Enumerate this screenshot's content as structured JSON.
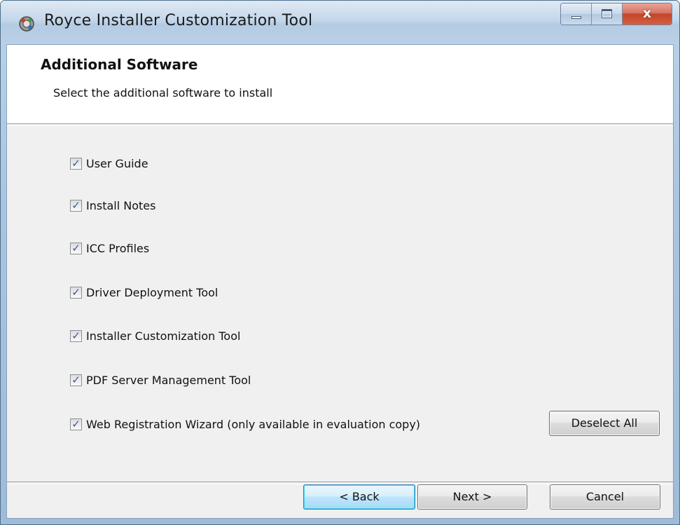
{
  "window": {
    "title": "Royce Installer Customization Tool",
    "app_icon": "installer-gear-icon",
    "controls": {
      "minimize_icon": "minimize-icon",
      "maximize_icon": "maximize-icon",
      "close_glyph": "x"
    }
  },
  "header": {
    "title": "Additional Software",
    "subtitle": "Select the additional software to install"
  },
  "options": [
    {
      "label": "User Guide",
      "checked": true
    },
    {
      "label": "Install Notes",
      "checked": true
    },
    {
      "label": "ICC Profiles",
      "checked": true
    },
    {
      "label": "Driver Deployment Tool",
      "checked": true
    },
    {
      "label": "Installer Customization Tool",
      "checked": true
    },
    {
      "label": "PDF Server Management Tool",
      "checked": true
    },
    {
      "label": "Web Registration Wizard (only available in evaluation copy)",
      "checked": true
    }
  ],
  "check_glyph": "✓",
  "buttons": {
    "deselect_all": "Deselect All",
    "back": "< Back",
    "next": "Next >",
    "cancel": "Cancel"
  },
  "colors": {
    "titlebar": "#bcd3e8",
    "close_button": "#c2452c",
    "default_button_border": "#3c7fb1",
    "check_mark": "#3b55a0"
  }
}
